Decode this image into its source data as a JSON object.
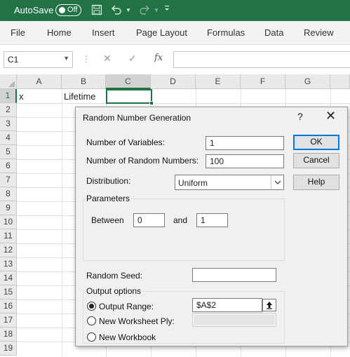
{
  "titlebar": {
    "autosave_label": "AutoSave",
    "autosave_state": "Off",
    "icons": [
      "save-icon",
      "undo-icon",
      "redo-icon",
      "customize-qat-icon"
    ],
    "accent": "#217346"
  },
  "ribbon": {
    "tabs": [
      "File",
      "Home",
      "Insert",
      "Page Layout",
      "Formulas",
      "Data",
      "Review"
    ]
  },
  "formula_bar": {
    "name_box": "C1",
    "formula": "",
    "fx_label": "fx"
  },
  "sheet": {
    "columns": [
      "A",
      "B",
      "C",
      "D",
      "E",
      "F",
      "G"
    ],
    "rows": [
      "1",
      "2",
      "3",
      "4",
      "5",
      "6",
      "7",
      "8",
      "9",
      "10",
      "11",
      "12",
      "13",
      "14",
      "15",
      "16",
      "17",
      "18",
      "19"
    ],
    "active_cell": "C1",
    "cells": {
      "A1": "x",
      "B1": "Lifetime"
    }
  },
  "dialog": {
    "title": "Random Number Generation",
    "help": "?",
    "close": "✕",
    "num_variables_label": "Number of Variables:",
    "num_variables_value": "1",
    "num_random_label": "Number of Random Numbers:",
    "num_random_value": "100",
    "distribution_label": "Distribution:",
    "distribution_value": "Uniform",
    "parameters_title": "Parameters",
    "between_label": "Between",
    "between_value": "0",
    "and_label": "and",
    "and_value": "1",
    "random_seed_label": "Random Seed:",
    "random_seed_value": "",
    "output_title": "Output options",
    "output_range_label": "Output Range:",
    "output_range_value": "$A$2",
    "new_worksheet_label": "New Worksheet Ply:",
    "new_workbook_label": "New Workbook",
    "selected_output": "Output Range",
    "buttons": {
      "ok": "OK",
      "cancel": "Cancel",
      "help": "Help"
    }
  }
}
